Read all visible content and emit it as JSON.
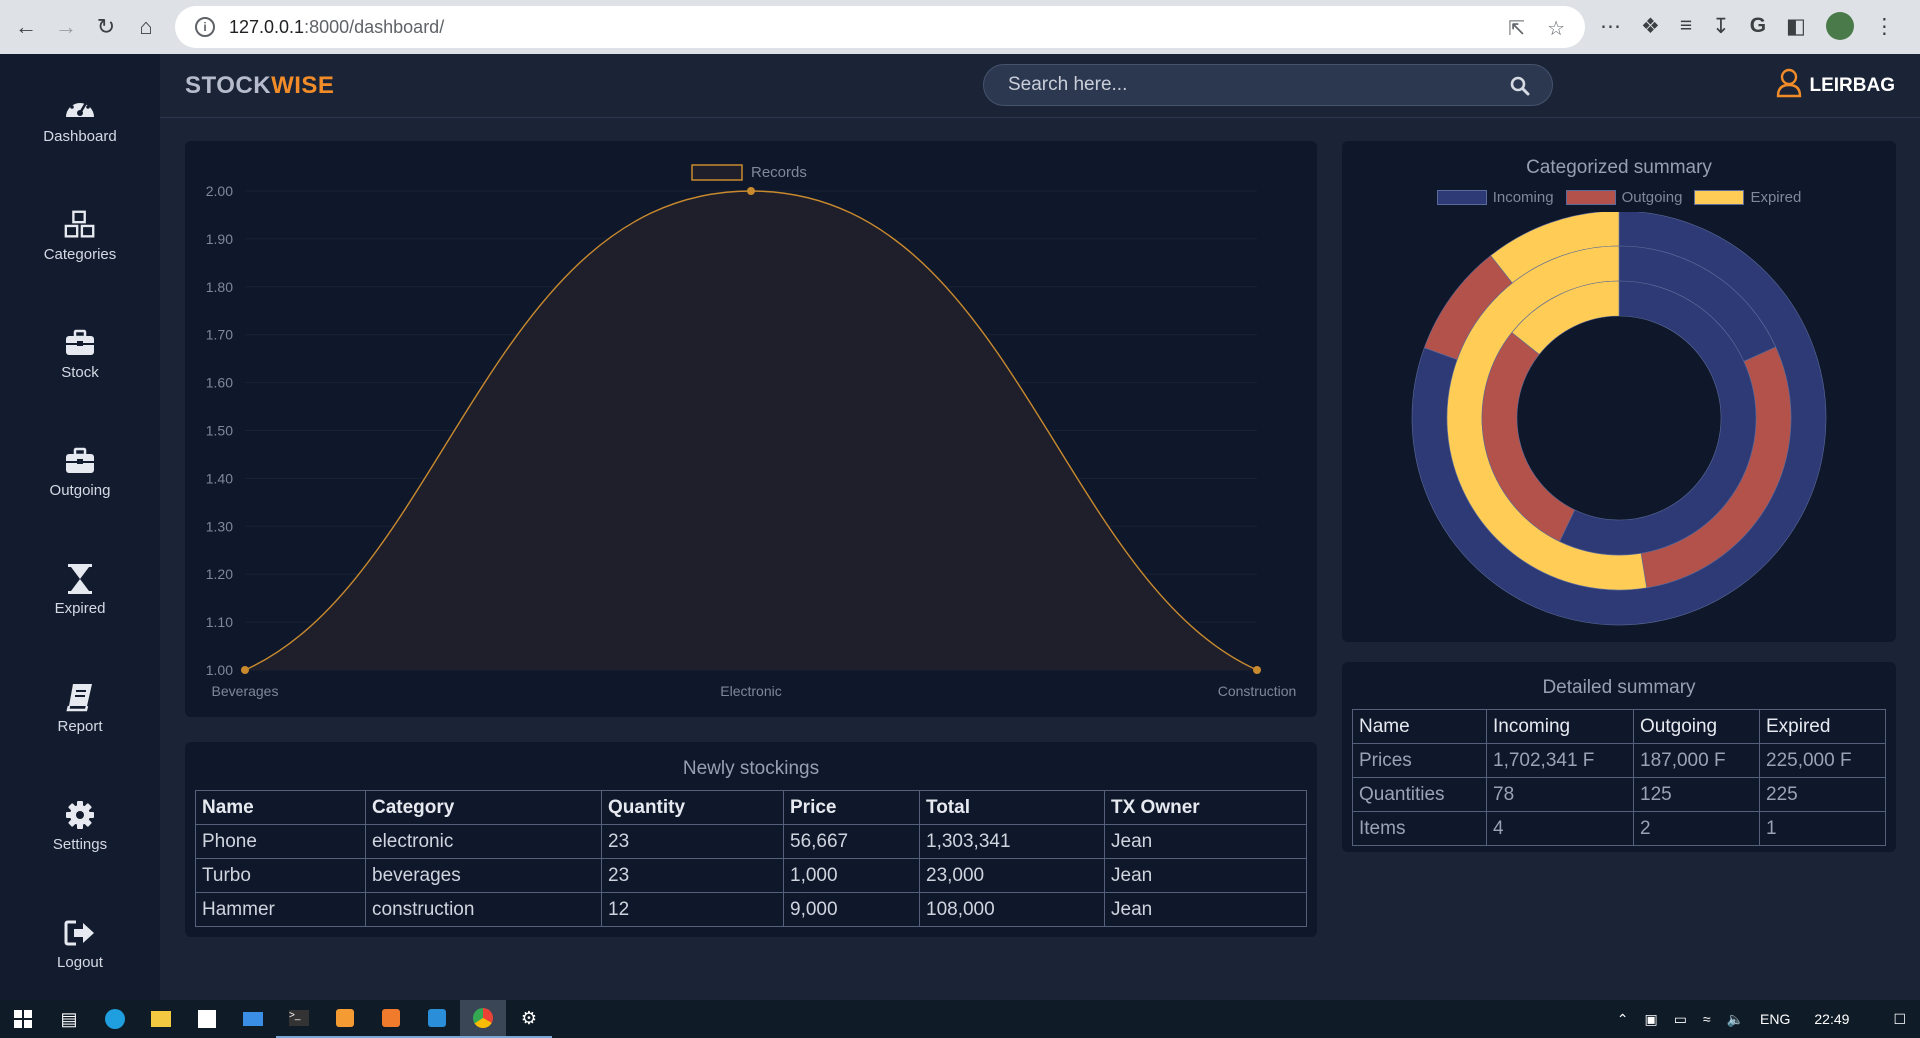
{
  "browser": {
    "url_host": "127.0.0.1",
    "url_path": ":8000/dashboard/"
  },
  "brand": {
    "part1": "STOCK",
    "part2": "WISE",
    "accent": "#f28c28"
  },
  "search": {
    "placeholder": "Search here..."
  },
  "user": {
    "name": "LEIRBAG"
  },
  "sidebar": {
    "items": [
      {
        "label": "Dashboard",
        "icon": "dashboard-icon"
      },
      {
        "label": "Categories",
        "icon": "cubes-icon"
      },
      {
        "label": "Stock",
        "icon": "briefcase-icon"
      },
      {
        "label": "Outgoing",
        "icon": "briefcase-icon"
      },
      {
        "label": "Expired",
        "icon": "hourglass-icon"
      },
      {
        "label": "Report",
        "icon": "book-icon"
      },
      {
        "label": "Settings",
        "icon": "gear-icon"
      },
      {
        "label": "Logout",
        "icon": "logout-icon"
      }
    ]
  },
  "line_chart": {
    "legend": "Records",
    "categories": [
      "Beverages",
      "Electronic",
      "Construction"
    ],
    "values": [
      1,
      2,
      1
    ],
    "yticks": [
      "2.00",
      "1.90",
      "1.80",
      "1.70",
      "1.60",
      "1.50",
      "1.40",
      "1.30",
      "1.20",
      "1.10",
      "1.00"
    ],
    "ylim": [
      1,
      2
    ],
    "color": "#c98a2e"
  },
  "newly": {
    "title": "Newly stockings",
    "headers": [
      "Name",
      "Category",
      "Quantity",
      "Price",
      "Total",
      "TX Owner"
    ],
    "rows": [
      [
        "Phone",
        "electronic",
        "23",
        "56,667",
        "1,303,341",
        "Jean"
      ],
      [
        "Turbo",
        "beverages",
        "23",
        "1,000",
        "23,000",
        "Jean"
      ],
      [
        "Hammer",
        "construction",
        "12",
        "9,000",
        "108,000",
        "Jean"
      ]
    ]
  },
  "doughnut": {
    "title": "Categorized summary",
    "legend": [
      {
        "label": "Incoming",
        "color": "#2e3a75"
      },
      {
        "label": "Outgoing",
        "color": "#b3524a"
      },
      {
        "label": "Expired",
        "color": "#ffcd56"
      }
    ]
  },
  "detailed": {
    "title": "Detailed summary",
    "headers": [
      "Name",
      "Incoming",
      "Outgoing",
      "Expired"
    ],
    "rows": [
      [
        "Prices",
        "1,702,341 F",
        "187,000 F",
        "225,000 F"
      ],
      [
        "Quantities",
        "78",
        "125",
        "225"
      ],
      [
        "Items",
        "4",
        "2",
        "1"
      ]
    ]
  },
  "chart_data": [
    {
      "type": "line",
      "categories": [
        "Beverages",
        "Electronic",
        "Construction"
      ],
      "series": [
        {
          "name": "Records",
          "values": [
            1,
            2,
            1
          ]
        }
      ],
      "ylim": [
        1,
        2
      ],
      "title": ""
    },
    {
      "type": "pie",
      "title": "Categorized summary",
      "categories": [
        "Incoming",
        "Outgoing",
        "Expired"
      ],
      "series": [
        {
          "values": [
            1702341,
            187000,
            225000
          ]
        },
        {
          "values": [
            78,
            125,
            225
          ]
        },
        {
          "values": [
            4,
            2,
            1
          ]
        }
      ]
    }
  ],
  "taskbar": {
    "lang": "ENG",
    "time": "22:49"
  }
}
